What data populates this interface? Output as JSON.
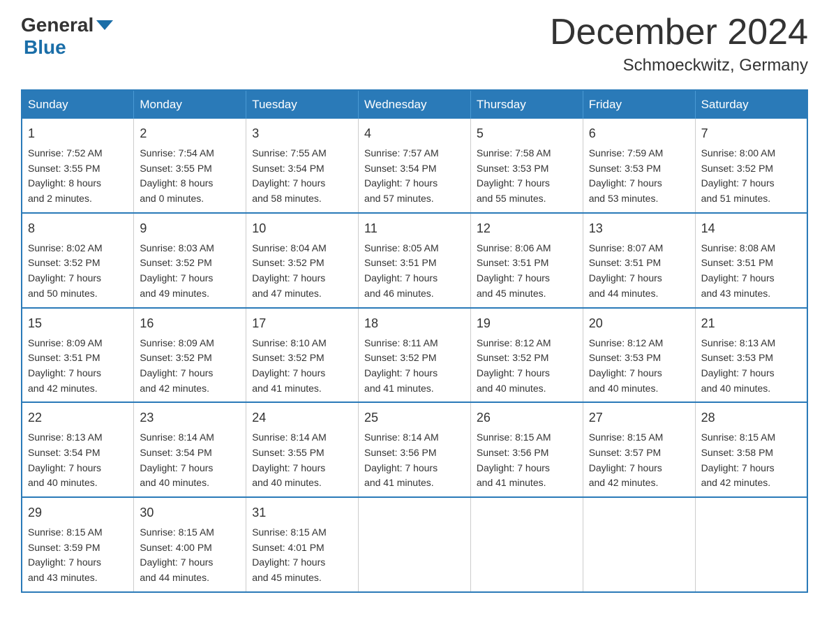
{
  "header": {
    "logo_general": "General",
    "logo_blue": "Blue",
    "month_title": "December 2024",
    "location": "Schmoeckwitz, Germany"
  },
  "columns": [
    "Sunday",
    "Monday",
    "Tuesday",
    "Wednesday",
    "Thursday",
    "Friday",
    "Saturday"
  ],
  "weeks": [
    [
      {
        "day": "1",
        "sunrise": "Sunrise: 7:52 AM",
        "sunset": "Sunset: 3:55 PM",
        "daylight": "Daylight: 8 hours",
        "daylight2": "and 2 minutes."
      },
      {
        "day": "2",
        "sunrise": "Sunrise: 7:54 AM",
        "sunset": "Sunset: 3:55 PM",
        "daylight": "Daylight: 8 hours",
        "daylight2": "and 0 minutes."
      },
      {
        "day": "3",
        "sunrise": "Sunrise: 7:55 AM",
        "sunset": "Sunset: 3:54 PM",
        "daylight": "Daylight: 7 hours",
        "daylight2": "and 58 minutes."
      },
      {
        "day": "4",
        "sunrise": "Sunrise: 7:57 AM",
        "sunset": "Sunset: 3:54 PM",
        "daylight": "Daylight: 7 hours",
        "daylight2": "and 57 minutes."
      },
      {
        "day": "5",
        "sunrise": "Sunrise: 7:58 AM",
        "sunset": "Sunset: 3:53 PM",
        "daylight": "Daylight: 7 hours",
        "daylight2": "and 55 minutes."
      },
      {
        "day": "6",
        "sunrise": "Sunrise: 7:59 AM",
        "sunset": "Sunset: 3:53 PM",
        "daylight": "Daylight: 7 hours",
        "daylight2": "and 53 minutes."
      },
      {
        "day": "7",
        "sunrise": "Sunrise: 8:00 AM",
        "sunset": "Sunset: 3:52 PM",
        "daylight": "Daylight: 7 hours",
        "daylight2": "and 51 minutes."
      }
    ],
    [
      {
        "day": "8",
        "sunrise": "Sunrise: 8:02 AM",
        "sunset": "Sunset: 3:52 PM",
        "daylight": "Daylight: 7 hours",
        "daylight2": "and 50 minutes."
      },
      {
        "day": "9",
        "sunrise": "Sunrise: 8:03 AM",
        "sunset": "Sunset: 3:52 PM",
        "daylight": "Daylight: 7 hours",
        "daylight2": "and 49 minutes."
      },
      {
        "day": "10",
        "sunrise": "Sunrise: 8:04 AM",
        "sunset": "Sunset: 3:52 PM",
        "daylight": "Daylight: 7 hours",
        "daylight2": "and 47 minutes."
      },
      {
        "day": "11",
        "sunrise": "Sunrise: 8:05 AM",
        "sunset": "Sunset: 3:51 PM",
        "daylight": "Daylight: 7 hours",
        "daylight2": "and 46 minutes."
      },
      {
        "day": "12",
        "sunrise": "Sunrise: 8:06 AM",
        "sunset": "Sunset: 3:51 PM",
        "daylight": "Daylight: 7 hours",
        "daylight2": "and 45 minutes."
      },
      {
        "day": "13",
        "sunrise": "Sunrise: 8:07 AM",
        "sunset": "Sunset: 3:51 PM",
        "daylight": "Daylight: 7 hours",
        "daylight2": "and 44 minutes."
      },
      {
        "day": "14",
        "sunrise": "Sunrise: 8:08 AM",
        "sunset": "Sunset: 3:51 PM",
        "daylight": "Daylight: 7 hours",
        "daylight2": "and 43 minutes."
      }
    ],
    [
      {
        "day": "15",
        "sunrise": "Sunrise: 8:09 AM",
        "sunset": "Sunset: 3:51 PM",
        "daylight": "Daylight: 7 hours",
        "daylight2": "and 42 minutes."
      },
      {
        "day": "16",
        "sunrise": "Sunrise: 8:09 AM",
        "sunset": "Sunset: 3:52 PM",
        "daylight": "Daylight: 7 hours",
        "daylight2": "and 42 minutes."
      },
      {
        "day": "17",
        "sunrise": "Sunrise: 8:10 AM",
        "sunset": "Sunset: 3:52 PM",
        "daylight": "Daylight: 7 hours",
        "daylight2": "and 41 minutes."
      },
      {
        "day": "18",
        "sunrise": "Sunrise: 8:11 AM",
        "sunset": "Sunset: 3:52 PM",
        "daylight": "Daylight: 7 hours",
        "daylight2": "and 41 minutes."
      },
      {
        "day": "19",
        "sunrise": "Sunrise: 8:12 AM",
        "sunset": "Sunset: 3:52 PM",
        "daylight": "Daylight: 7 hours",
        "daylight2": "and 40 minutes."
      },
      {
        "day": "20",
        "sunrise": "Sunrise: 8:12 AM",
        "sunset": "Sunset: 3:53 PM",
        "daylight": "Daylight: 7 hours",
        "daylight2": "and 40 minutes."
      },
      {
        "day": "21",
        "sunrise": "Sunrise: 8:13 AM",
        "sunset": "Sunset: 3:53 PM",
        "daylight": "Daylight: 7 hours",
        "daylight2": "and 40 minutes."
      }
    ],
    [
      {
        "day": "22",
        "sunrise": "Sunrise: 8:13 AM",
        "sunset": "Sunset: 3:54 PM",
        "daylight": "Daylight: 7 hours",
        "daylight2": "and 40 minutes."
      },
      {
        "day": "23",
        "sunrise": "Sunrise: 8:14 AM",
        "sunset": "Sunset: 3:54 PM",
        "daylight": "Daylight: 7 hours",
        "daylight2": "and 40 minutes."
      },
      {
        "day": "24",
        "sunrise": "Sunrise: 8:14 AM",
        "sunset": "Sunset: 3:55 PM",
        "daylight": "Daylight: 7 hours",
        "daylight2": "and 40 minutes."
      },
      {
        "day": "25",
        "sunrise": "Sunrise: 8:14 AM",
        "sunset": "Sunset: 3:56 PM",
        "daylight": "Daylight: 7 hours",
        "daylight2": "and 41 minutes."
      },
      {
        "day": "26",
        "sunrise": "Sunrise: 8:15 AM",
        "sunset": "Sunset: 3:56 PM",
        "daylight": "Daylight: 7 hours",
        "daylight2": "and 41 minutes."
      },
      {
        "day": "27",
        "sunrise": "Sunrise: 8:15 AM",
        "sunset": "Sunset: 3:57 PM",
        "daylight": "Daylight: 7 hours",
        "daylight2": "and 42 minutes."
      },
      {
        "day": "28",
        "sunrise": "Sunrise: 8:15 AM",
        "sunset": "Sunset: 3:58 PM",
        "daylight": "Daylight: 7 hours",
        "daylight2": "and 42 minutes."
      }
    ],
    [
      {
        "day": "29",
        "sunrise": "Sunrise: 8:15 AM",
        "sunset": "Sunset: 3:59 PM",
        "daylight": "Daylight: 7 hours",
        "daylight2": "and 43 minutes."
      },
      {
        "day": "30",
        "sunrise": "Sunrise: 8:15 AM",
        "sunset": "Sunset: 4:00 PM",
        "daylight": "Daylight: 7 hours",
        "daylight2": "and 44 minutes."
      },
      {
        "day": "31",
        "sunrise": "Sunrise: 8:15 AM",
        "sunset": "Sunset: 4:01 PM",
        "daylight": "Daylight: 7 hours",
        "daylight2": "and 45 minutes."
      },
      null,
      null,
      null,
      null
    ]
  ]
}
